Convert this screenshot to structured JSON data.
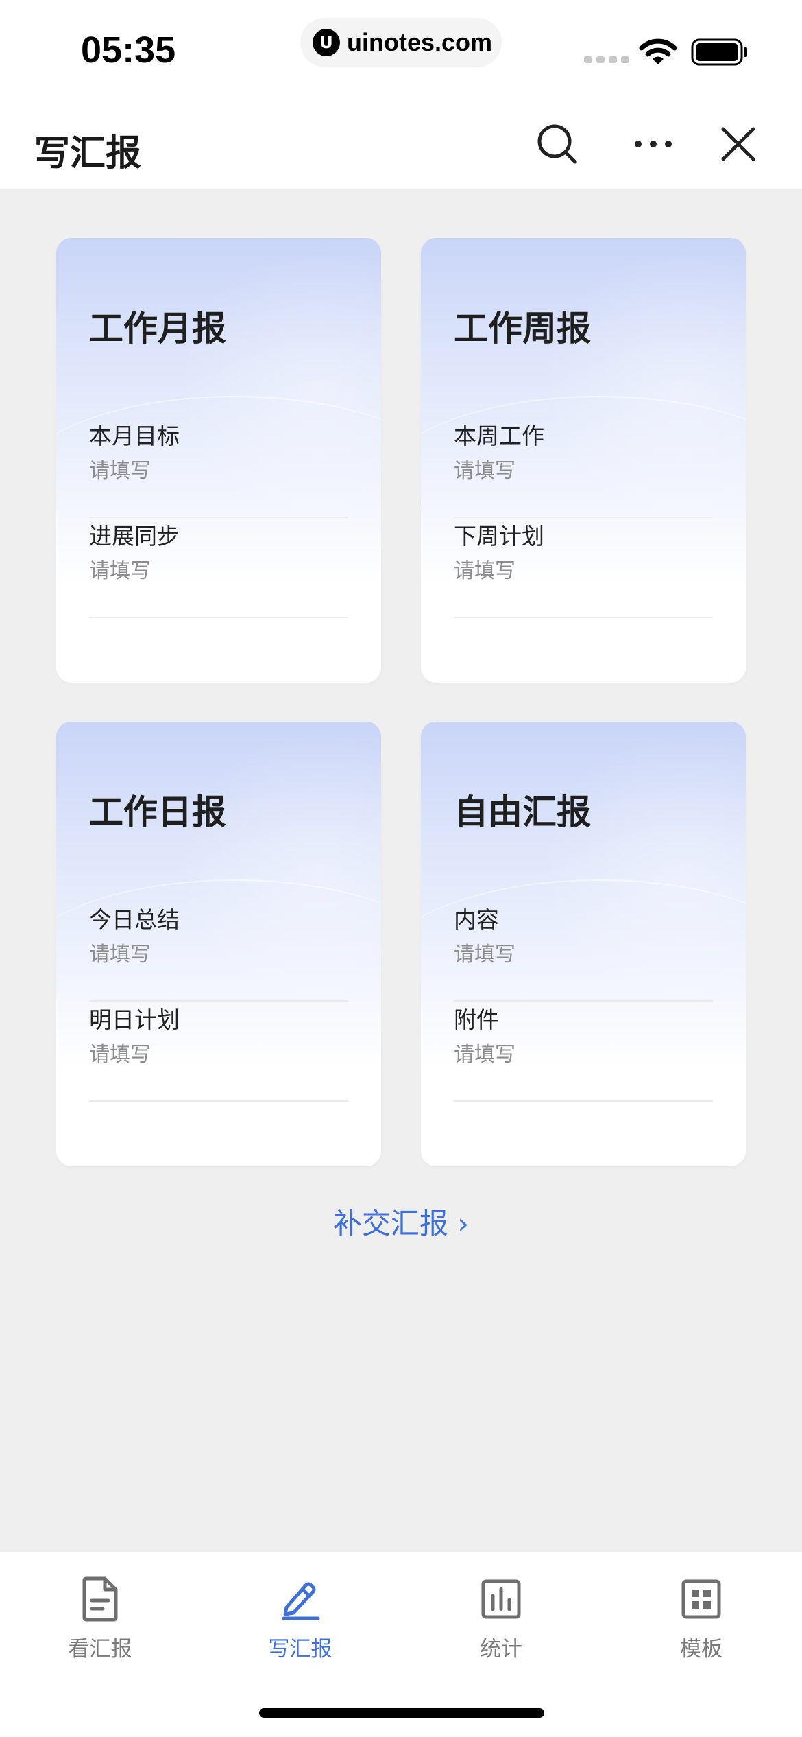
{
  "status_bar": {
    "time": "05:35",
    "url": "uinotes.com",
    "logo_letter": "U"
  },
  "header": {
    "title": "写汇报"
  },
  "cards": [
    {
      "title": "工作月报",
      "fields": [
        {
          "label": "本月目标",
          "placeholder": "请填写"
        },
        {
          "label": "进展同步",
          "placeholder": "请填写"
        }
      ]
    },
    {
      "title": "工作周报",
      "fields": [
        {
          "label": "本周工作",
          "placeholder": "请填写"
        },
        {
          "label": "下周计划",
          "placeholder": "请填写"
        }
      ]
    },
    {
      "title": "工作日报",
      "fields": [
        {
          "label": "今日总结",
          "placeholder": "请填写"
        },
        {
          "label": "明日计划",
          "placeholder": "请填写"
        }
      ]
    },
    {
      "title": "自由汇报",
      "fields": [
        {
          "label": "内容",
          "placeholder": "请填写"
        },
        {
          "label": "附件",
          "placeholder": "请填写"
        }
      ]
    }
  ],
  "resubmit_link": "补交汇报 ›",
  "tabbar": {
    "active": "写汇报",
    "items": [
      {
        "label": "看汇报",
        "icon": "document-icon"
      },
      {
        "label": "写汇报",
        "icon": "pen-icon"
      },
      {
        "label": "统计",
        "icon": "bar-chart-icon"
      },
      {
        "label": "模板",
        "icon": "grid-template-icon"
      }
    ]
  },
  "colors": {
    "accent": "#3f6fd9",
    "background": "#efefef",
    "card_gradient_top": "#c9d5f8"
  }
}
